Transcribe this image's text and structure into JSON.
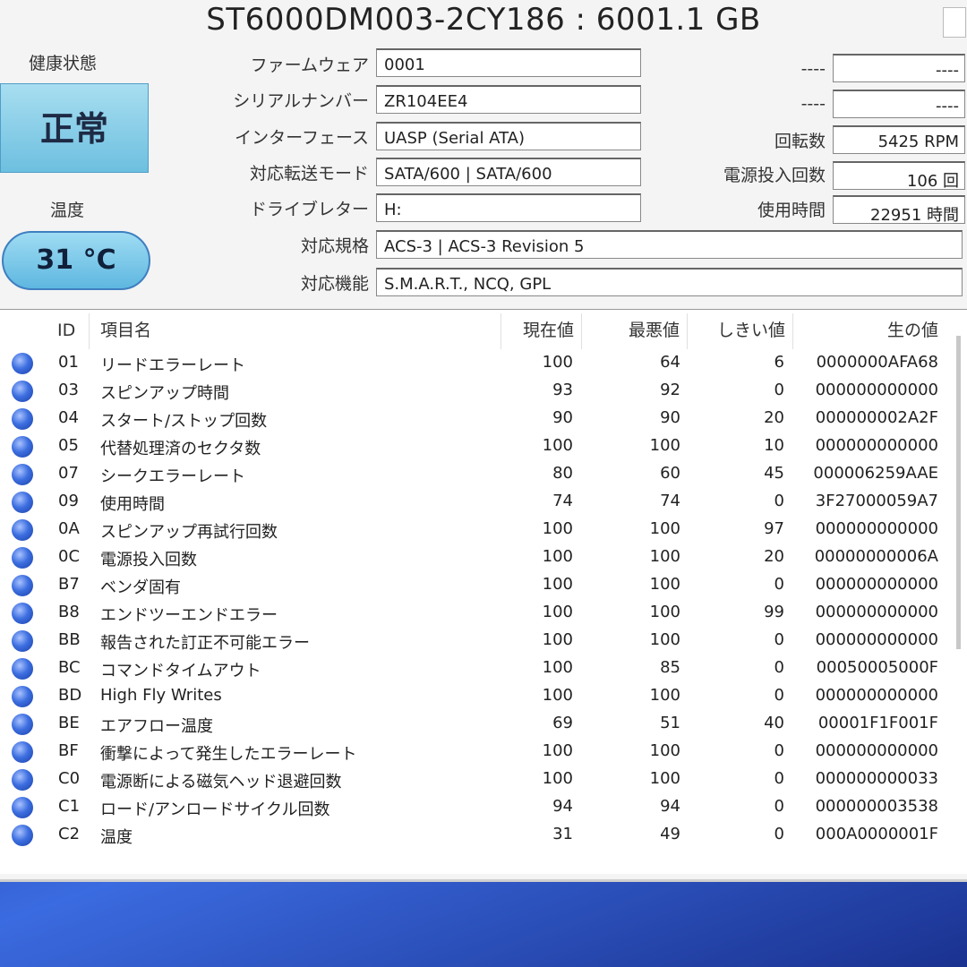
{
  "title": "ST6000DM003-2CY186 : 6001.1 GB",
  "health": {
    "label": "健康状態",
    "value": "正常"
  },
  "temperature": {
    "label": "温度",
    "value": "31 °C"
  },
  "info_left": [
    {
      "label": "ファームウェア",
      "value": "0001"
    },
    {
      "label": "シリアルナンバー",
      "value": "ZR104EE4"
    },
    {
      "label": "インターフェース",
      "value": "UASP (Serial ATA)"
    },
    {
      "label": "対応転送モード",
      "value": "SATA/600 | SATA/600"
    },
    {
      "label": "ドライブレター",
      "value": "H:"
    }
  ],
  "info_wide": [
    {
      "label": "対応規格",
      "value": "ACS-3 | ACS-3 Revision 5"
    },
    {
      "label": "対応機能",
      "value": "S.M.A.R.T., NCQ, GPL"
    }
  ],
  "info_right": [
    {
      "label": "----",
      "value": "----"
    },
    {
      "label": "----",
      "value": "----"
    },
    {
      "label": "回転数",
      "value": "5425 RPM"
    },
    {
      "label": "電源投入回数",
      "value": "106 回"
    },
    {
      "label": "使用時間",
      "value": "22951 時間"
    }
  ],
  "table_headers": {
    "id": "ID",
    "name": "項目名",
    "current": "現在値",
    "worst": "最悪値",
    "threshold": "しきい値",
    "raw": "生の値"
  },
  "rows": [
    {
      "id": "01",
      "name": "リードエラーレート",
      "current": "100",
      "worst": "64",
      "threshold": "6",
      "raw": "0000000AFA68"
    },
    {
      "id": "03",
      "name": "スピンアップ時間",
      "current": "93",
      "worst": "92",
      "threshold": "0",
      "raw": "000000000000"
    },
    {
      "id": "04",
      "name": "スタート/ストップ回数",
      "current": "90",
      "worst": "90",
      "threshold": "20",
      "raw": "000000002A2F"
    },
    {
      "id": "05",
      "name": "代替処理済のセクタ数",
      "current": "100",
      "worst": "100",
      "threshold": "10",
      "raw": "000000000000"
    },
    {
      "id": "07",
      "name": "シークエラーレート",
      "current": "80",
      "worst": "60",
      "threshold": "45",
      "raw": "000006259AAE"
    },
    {
      "id": "09",
      "name": "使用時間",
      "current": "74",
      "worst": "74",
      "threshold": "0",
      "raw": "3F27000059A7"
    },
    {
      "id": "0A",
      "name": "スピンアップ再試行回数",
      "current": "100",
      "worst": "100",
      "threshold": "97",
      "raw": "000000000000"
    },
    {
      "id": "0C",
      "name": "電源投入回数",
      "current": "100",
      "worst": "100",
      "threshold": "20",
      "raw": "00000000006A"
    },
    {
      "id": "B7",
      "name": "ベンダ固有",
      "current": "100",
      "worst": "100",
      "threshold": "0",
      "raw": "000000000000"
    },
    {
      "id": "B8",
      "name": "エンドツーエンドエラー",
      "current": "100",
      "worst": "100",
      "threshold": "99",
      "raw": "000000000000"
    },
    {
      "id": "BB",
      "name": "報告された訂正不可能エラー",
      "current": "100",
      "worst": "100",
      "threshold": "0",
      "raw": "000000000000"
    },
    {
      "id": "BC",
      "name": "コマンドタイムアウト",
      "current": "100",
      "worst": "85",
      "threshold": "0",
      "raw": "00050005000F"
    },
    {
      "id": "BD",
      "name": "High Fly Writes",
      "current": "100",
      "worst": "100",
      "threshold": "0",
      "raw": "000000000000"
    },
    {
      "id": "BE",
      "name": "エアフロー温度",
      "current": "69",
      "worst": "51",
      "threshold": "40",
      "raw": "00001F1F001F"
    },
    {
      "id": "BF",
      "name": "衝撃によって発生したエラーレート",
      "current": "100",
      "worst": "100",
      "threshold": "0",
      "raw": "000000000000"
    },
    {
      "id": "C0",
      "name": "電源断による磁気ヘッド退避回数",
      "current": "100",
      "worst": "100",
      "threshold": "0",
      "raw": "000000000033"
    },
    {
      "id": "C1",
      "name": "ロード/アンロードサイクル回数",
      "current": "94",
      "worst": "94",
      "threshold": "0",
      "raw": "000000003538"
    },
    {
      "id": "C2",
      "name": "温度",
      "current": "31",
      "worst": "49",
      "threshold": "0",
      "raw": "000A0000001F"
    }
  ]
}
